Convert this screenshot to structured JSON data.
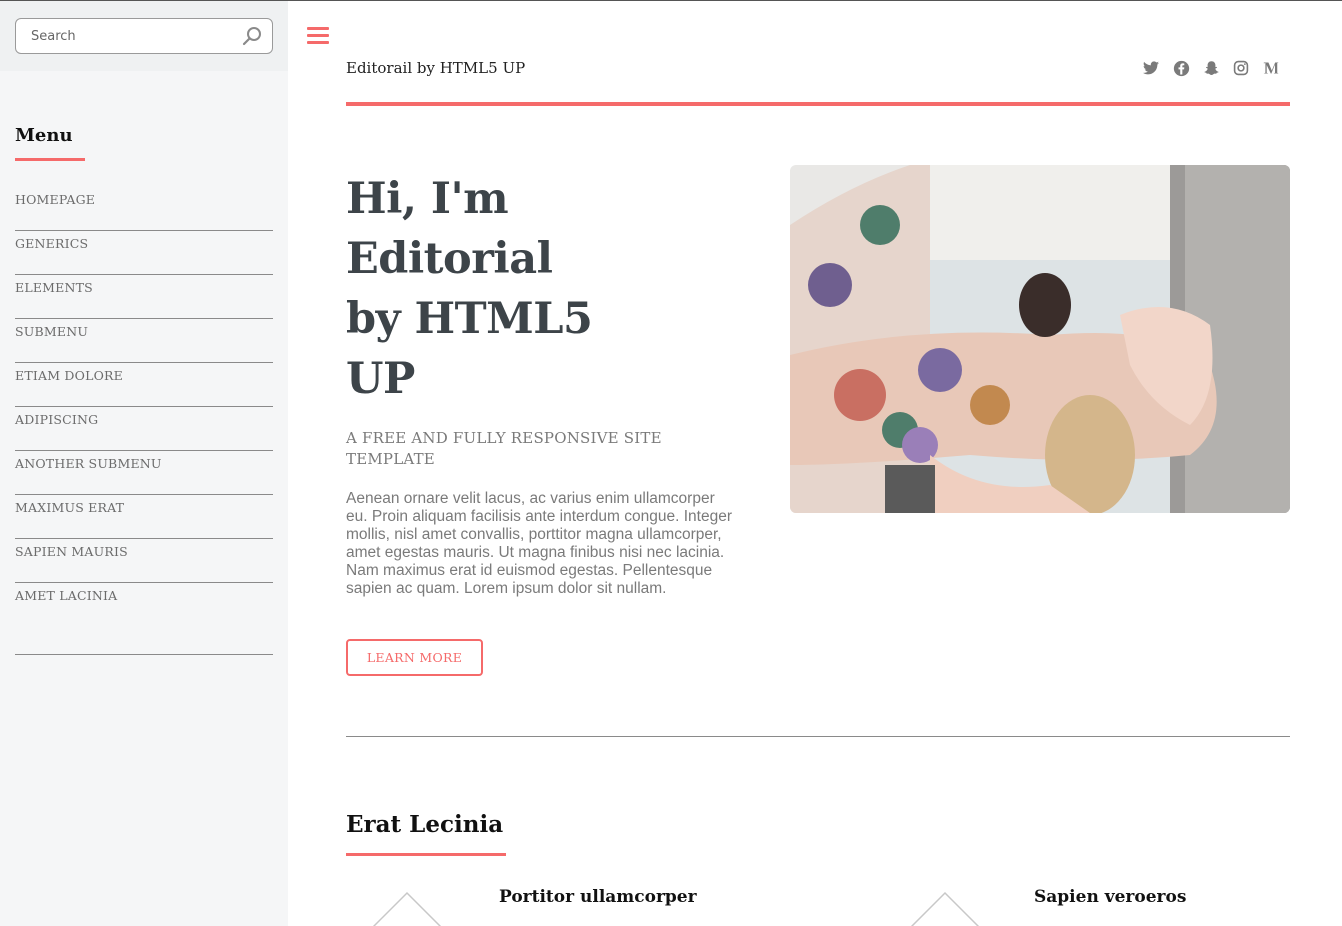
{
  "sidebar": {
    "search": {
      "placeholder": "Search"
    },
    "menu_title": "Menu",
    "items": [
      {
        "label": "HOMEPAGE"
      },
      {
        "label": "GENERICS"
      },
      {
        "label": "ELEMENTS"
      },
      {
        "label": "SUBMENU"
      },
      {
        "label": "ETIAM DOLORE"
      },
      {
        "label": "ADIPISCING"
      },
      {
        "label": "ANOTHER SUBMENU"
      },
      {
        "label": "MAXIMUS ERAT"
      },
      {
        "label": "SAPIEN MAURIS"
      },
      {
        "label": "AMET LACINIA"
      }
    ]
  },
  "header": {
    "title": "Editorail by HTML5 UP",
    "social_icons": [
      "twitter-icon",
      "facebook-icon",
      "snapchat-icon",
      "instagram-icon",
      "medium-icon"
    ]
  },
  "hero": {
    "title_lines": [
      "Hi, I'm",
      "Editorial",
      "by HTML5",
      "UP"
    ],
    "subtitle": "A FREE AND FULLY RESPONSIVE SITE TEMPLATE",
    "body": "Aenean ornare velit lacus, ac varius enim ullamcorper eu. Proin aliquam facilisis ante interdum congue. Integer mollis, nisl amet convallis, porttitor magna ullamcorper, amet egestas mauris. Ut magna finibus nisi nec lacinia. Nam maximus erat id euismod egestas. Pellentesque sapien ac quam. Lorem ipsum dolor sit nullam.",
    "button_label": "LEARN MORE"
  },
  "section": {
    "title": "Erat Lecinia",
    "features": [
      {
        "title": "Portitor ullamcorper"
      },
      {
        "title": "Sapien veroeros"
      }
    ]
  },
  "colors": {
    "accent": "#f56a6a",
    "text": "#3d4449",
    "sidebar_bg": "#f5f6f7"
  }
}
